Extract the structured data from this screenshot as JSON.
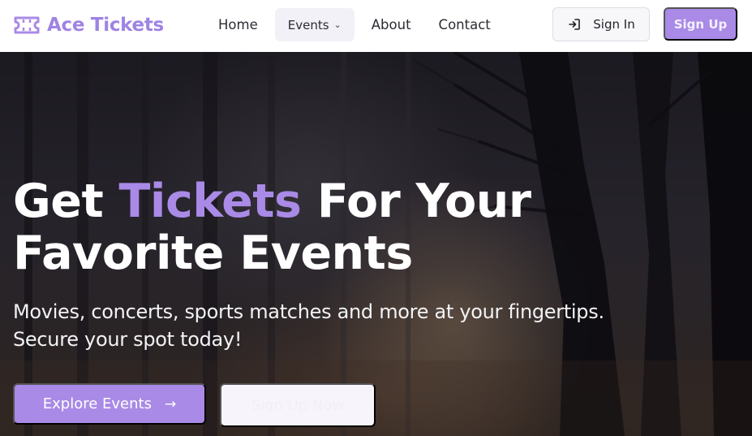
{
  "brand": {
    "name": "Ace Tickets",
    "icon": "ticket-icon",
    "color": "#9f83e4"
  },
  "nav": {
    "links": [
      {
        "label": "Home"
      },
      {
        "label": "Events",
        "icon": "chevron-down-icon"
      },
      {
        "label": "About"
      },
      {
        "label": "Contact"
      }
    ]
  },
  "auth": {
    "sign_in_label": "Sign In",
    "sign_in_icon": "login-icon",
    "sign_up_label": "Sign Up"
  },
  "hero": {
    "title_part1": "Get ",
    "title_accent": "Tickets",
    "title_part2": " For Your",
    "title_line2": "Favorite Events",
    "subtitle_line1": "Movies, concerts, sports matches and more at your fingertips.",
    "subtitle_line2": "Secure your spot today!",
    "explore_label": "Explore Events",
    "explore_icon": "arrow-right-icon",
    "signup_now_label": "Sign Up Now",
    "background": "dark-forest-image"
  },
  "colors": {
    "accent": "#a98ae6",
    "text_dark": "#2b2b33"
  }
}
